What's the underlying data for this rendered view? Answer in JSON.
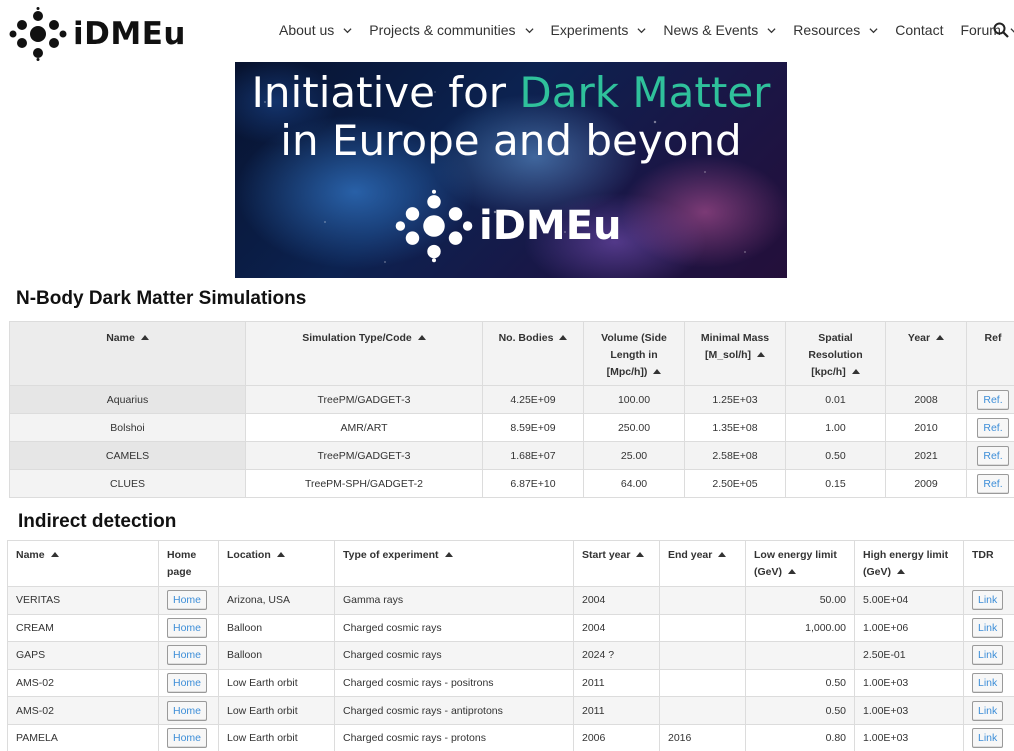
{
  "header": {
    "logo_text": "iDMEu",
    "nav": [
      {
        "label": "About us",
        "dropdown": true
      },
      {
        "label": "Projects & communities",
        "dropdown": true
      },
      {
        "label": "Experiments",
        "dropdown": true
      },
      {
        "label": "News & Events",
        "dropdown": true
      },
      {
        "label": "Resources",
        "dropdown": true
      },
      {
        "label": "Contact",
        "dropdown": false
      },
      {
        "label": "Forum",
        "dropdown": true
      }
    ],
    "search_icon": "search-icon"
  },
  "banner": {
    "line1_prefix": "Initiative for ",
    "line1_highlight": "Dark Matter",
    "line2": "in Europe and beyond",
    "logo_text": "iDMEu",
    "highlight_color": "#2fc19b"
  },
  "nbody": {
    "title": "N-Body Dark Matter Simulations",
    "headers": [
      "Name",
      "Simulation Type/Code",
      "No. Bodies",
      "Volume (Side Length in [Mpc/h])",
      "Minimal Mass [M_sol/h]",
      "Spatial Resolution [kpc/h]",
      "Year",
      "Ref"
    ],
    "rows": [
      {
        "name": "Aquarius",
        "code": "TreePM/GADGET-3",
        "bodies": "4.25E+09",
        "volume": "100.00",
        "mass": "1.25E+03",
        "resolution": "0.01",
        "year": "2008",
        "ref": "Ref."
      },
      {
        "name": "Bolshoi",
        "code": "AMR/ART",
        "bodies": "8.59E+09",
        "volume": "250.00",
        "mass": "1.35E+08",
        "resolution": "1.00",
        "year": "2010",
        "ref": "Ref."
      },
      {
        "name": "CAMELS",
        "code": "TreePM/GADGET-3",
        "bodies": "1.68E+07",
        "volume": "25.00",
        "mass": "2.58E+08",
        "resolution": "0.50",
        "year": "2021",
        "ref": "Ref."
      },
      {
        "name": "CLUES",
        "code": "TreePM-SPH/GADGET-2",
        "bodies": "6.87E+10",
        "volume": "64.00",
        "mass": "2.50E+05",
        "resolution": "0.15",
        "year": "2009",
        "ref": "Ref."
      }
    ]
  },
  "indirect": {
    "title": "Indirect detection",
    "headers": [
      "Name",
      "Home page",
      "Location",
      "Type of experiment",
      "Start year",
      "End year",
      "Low energy limit (GeV)",
      "High energy limit (GeV)",
      "TDR"
    ],
    "rows": [
      {
        "name": "VERITAS",
        "home": "Home",
        "location": "Arizona, USA",
        "type": "Gamma rays",
        "start": "2004",
        "end": "",
        "low": "50.00",
        "high": "5.00E+04",
        "tdr": "Link"
      },
      {
        "name": "CREAM",
        "home": "Home",
        "location": "Balloon",
        "type": "Charged cosmic rays",
        "start": "2004",
        "end": "",
        "low": "1,000.00",
        "high": "1.00E+06",
        "tdr": "Link"
      },
      {
        "name": "GAPS",
        "home": "Home",
        "location": "Balloon",
        "type": "Charged cosmic rays",
        "start": "2024 ?",
        "end": "",
        "low": "",
        "high": "2.50E-01",
        "tdr": "Link"
      },
      {
        "name": "AMS-02",
        "home": "Home",
        "location": "Low Earth orbit",
        "type": "Charged cosmic rays - positrons",
        "start": "2011",
        "end": "",
        "low": "0.50",
        "high": "1.00E+03",
        "tdr": "Link"
      },
      {
        "name": "AMS-02",
        "home": "Home",
        "location": "Low Earth orbit",
        "type": "Charged cosmic rays - antiprotons",
        "start": "2011",
        "end": "",
        "low": "0.50",
        "high": "1.00E+03",
        "tdr": "Link"
      },
      {
        "name": "PAMELA",
        "home": "Home",
        "location": "Low Earth orbit",
        "type": "Charged cosmic rays - protons",
        "start": "2006",
        "end": "2016",
        "low": "0.80",
        "high": "1.00E+03",
        "tdr": "Link"
      }
    ]
  }
}
